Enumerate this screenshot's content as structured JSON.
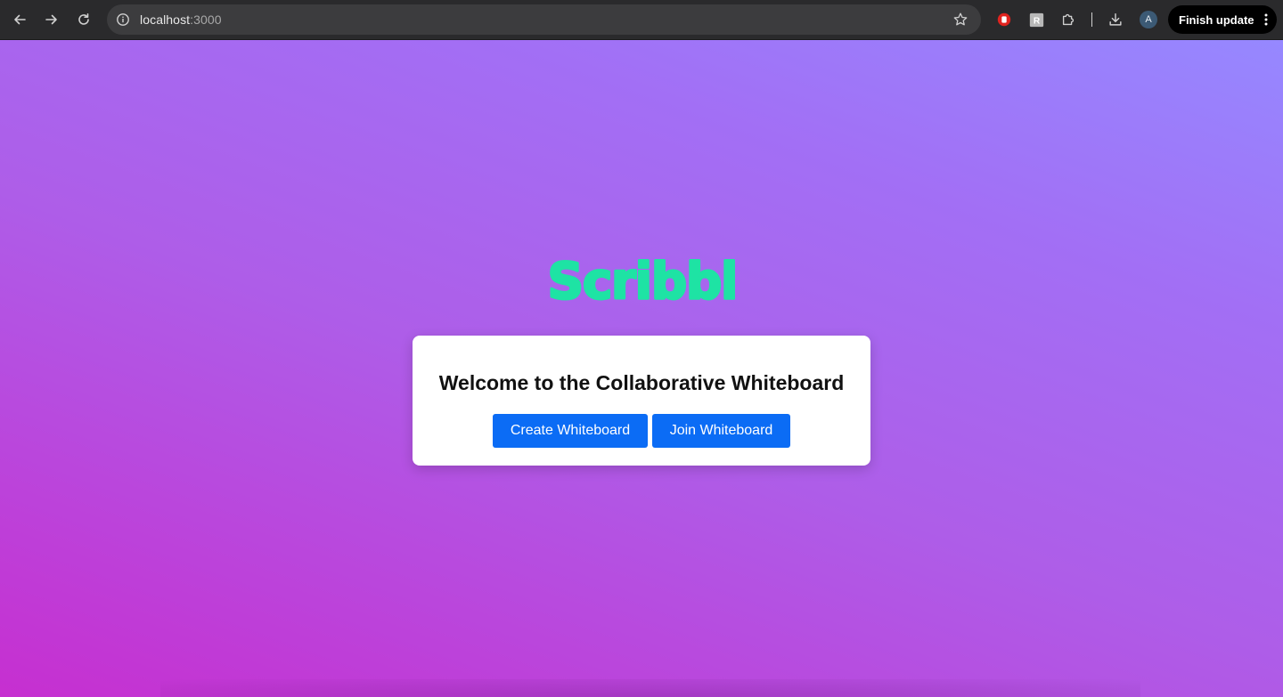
{
  "browser": {
    "url_host": "localhost",
    "url_port": ":3000",
    "finish_update_label": "Finish update",
    "avatar_letter": "A"
  },
  "page": {
    "logo_text": "Scribbl",
    "title": "Welcome to the Collaborative Whiteboard",
    "create_button": "Create Whiteboard",
    "join_button": "Join Whiteboard"
  },
  "colors": {
    "logo": "#1ee3a4",
    "button": "#0b6cf5",
    "card": "#ffffff"
  },
  "icons": {
    "back": "arrow-left-icon",
    "forward": "arrow-right-icon",
    "reload": "reload-icon",
    "info": "info-icon",
    "bookmark": "star-icon",
    "extension_1": "stop-hand-icon",
    "extension_2": "r-badge-icon",
    "extensions": "puzzle-icon",
    "downloads": "download-icon",
    "menu": "kebab-menu-icon"
  }
}
